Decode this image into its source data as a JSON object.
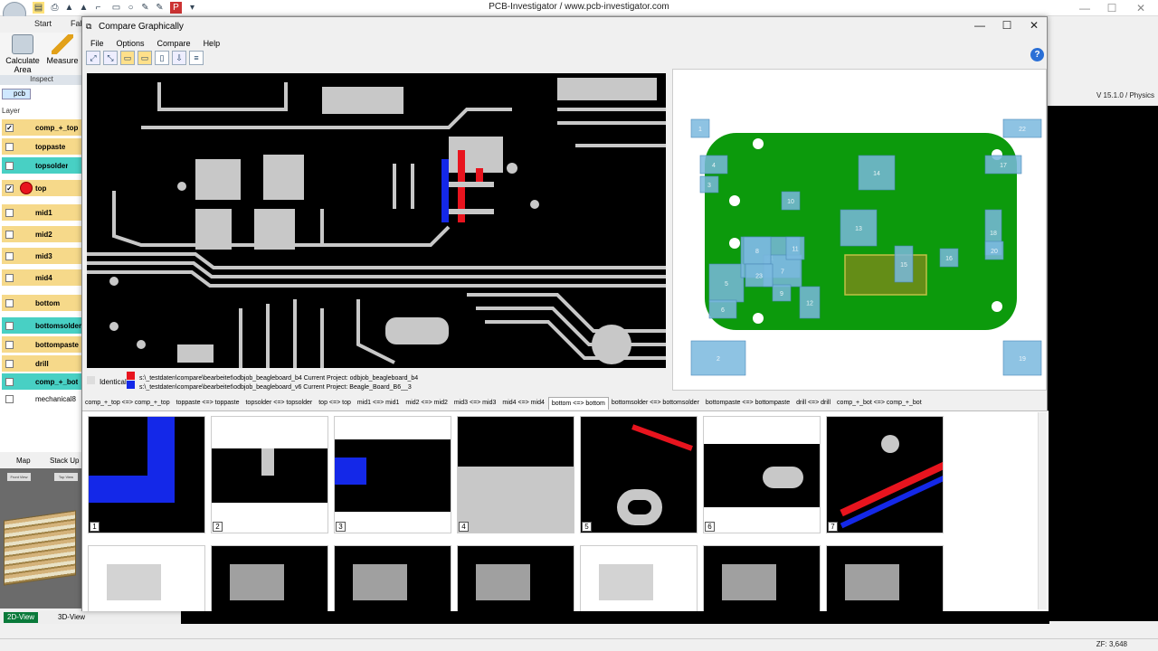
{
  "app": {
    "title": "PCB-Investigator  /  www.pcb-investigator.com",
    "version": "V 15.1.0 / Physics",
    "zoom": "ZF: 3,648"
  },
  "ribbon": {
    "tabs": [
      "Start",
      "Fab"
    ],
    "buttons": [
      {
        "label": "Calculate Area",
        "icon": "calculate-area-icon"
      },
      {
        "label": "Measure",
        "icon": "measure-icon"
      }
    ],
    "group": "Inspect"
  },
  "left_panel": {
    "tab": "pcb",
    "header": "Layer",
    "layers": [
      {
        "name": "comp_+_top",
        "checked": true,
        "color": "#f6d98a"
      },
      {
        "name": "toppaste",
        "checked": false,
        "color": "#f6d98a"
      },
      {
        "name": "topsolder",
        "checked": false,
        "color": "#48d0c4"
      },
      {
        "name": "top",
        "checked": true,
        "color": "#f6d98a"
      },
      {
        "name": "mid1",
        "checked": false,
        "color": "#f6d98a"
      },
      {
        "name": "mid2",
        "checked": false,
        "color": "#f6d98a"
      },
      {
        "name": "mid3",
        "checked": false,
        "color": "#f6d98a"
      },
      {
        "name": "mid4",
        "checked": false,
        "color": "#f6d98a"
      },
      {
        "name": "bottom",
        "checked": false,
        "color": "#f6d98a"
      },
      {
        "name": "bottomsolder",
        "checked": false,
        "color": "#48d0c4"
      },
      {
        "name": "bottompaste",
        "checked": false,
        "color": "#f6d98a"
      },
      {
        "name": "drill",
        "checked": false,
        "color": "#f6d98a"
      },
      {
        "name": "comp_+_bot",
        "checked": false,
        "color": "#48d0c4"
      },
      {
        "name": "mechanical8",
        "checked": false,
        "color": "#ffffff"
      }
    ],
    "bottom_tabs": [
      "Map",
      "Stack Up"
    ],
    "stack_labels": [
      "Front View",
      "Top View"
    ],
    "view_tabs": [
      "2D-View",
      "3D-View"
    ]
  },
  "dialog": {
    "title": "Compare Graphically",
    "menu": [
      "File",
      "Options",
      "Compare",
      "Help"
    ],
    "toolbar": [
      "zoom-icon",
      "zoom-fit-icon",
      "open-folder-icon",
      "open-folder-icon",
      "new-page-icon",
      "export-icon",
      "list-icon"
    ],
    "legend": {
      "identical": "Identical",
      "line1": "s:\\_testdaten\\compare\\bearbeitet\\odbjob_beagleboard_b4  Current Project: odbjob_beagleboard_b4",
      "line2": "s:\\_testdaten\\compare\\bearbeitet\\odbjob_beagleboard_v6  Current Project: Beagle_Board_B6__3"
    },
    "colors": {
      "board_green": "#0c9a0c",
      "diff_red": "#e8141e",
      "diff_blue": "#1428e8",
      "copper_grey": "#c8c8c8",
      "region_blue": "#7ab8de"
    },
    "layer_tabs": [
      "comp_+_top <=> comp_+_top",
      "toppaste <=> toppaste",
      "topsolder <=> topsolder",
      "top <=> top",
      "mid1 <=> mid1",
      "mid2 <=> mid2",
      "mid3 <=> mid3",
      "mid4 <=> mid4",
      "bottom <=> bottom",
      "bottomsolder <=> bottomsolder",
      "bottompaste <=> bottompaste",
      "drill <=> drill",
      "comp_+_bot <=> comp_+_bot"
    ],
    "active_tab": 8,
    "regions": [
      "1",
      "2",
      "3",
      "4",
      "5",
      "6",
      "7",
      "8",
      "9",
      "10",
      "11",
      "12",
      "13",
      "14",
      "15",
      "16",
      "17",
      "18",
      "19",
      "20",
      "21",
      "22",
      "23"
    ],
    "thumbnails_row1": [
      "1",
      "2",
      "3",
      "4",
      "5",
      "6",
      "7"
    ]
  }
}
